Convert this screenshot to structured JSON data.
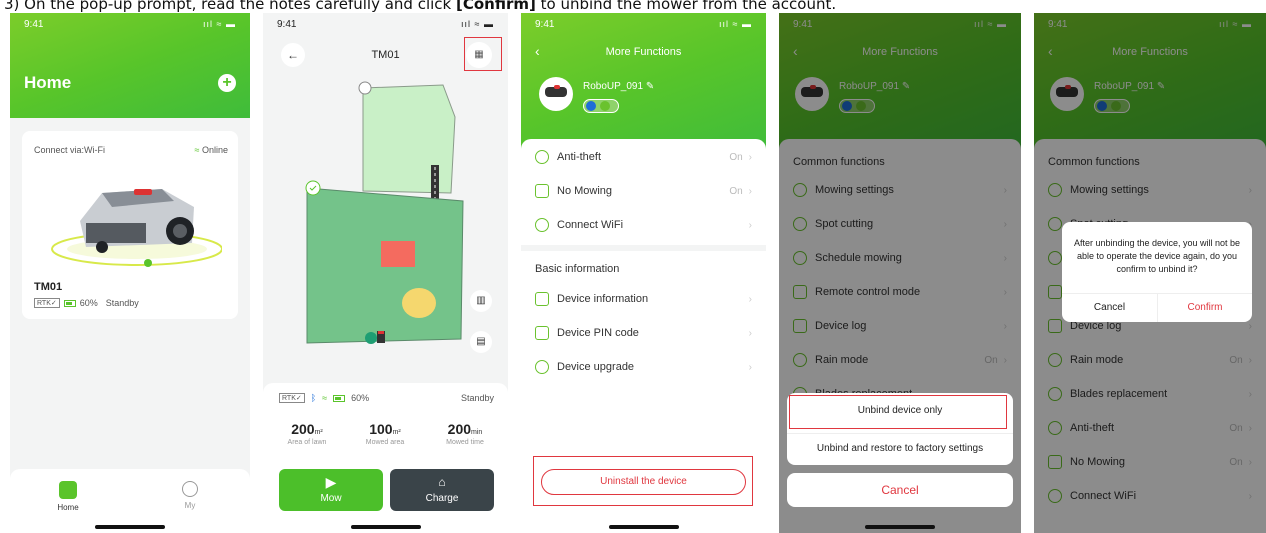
{
  "caption": {
    "prefix": "3)    On the pop-up prompt, read the notes carefully and click ",
    "bold": "[Confirm]",
    "suffix": " to unbind the mower from the account."
  },
  "status_time": "9:41",
  "status_icons": "ııl ≈ ▬",
  "screen1": {
    "title": "Home",
    "connect": "Connect via:Wi-Fi",
    "online": "Online",
    "device": "TM01",
    "rtk": "RTK✓",
    "battery": "60%",
    "state": "Standby",
    "tab_home": "Home",
    "tab_my": "My",
    "colors": {
      "accent": "#5ac42b"
    }
  },
  "screen2": {
    "title": "TM01",
    "rtk": "RTK✓",
    "battery": "60%",
    "state": "Standby",
    "stats": [
      {
        "value": "200",
        "unit": "m²",
        "label": "Area of lawn"
      },
      {
        "value": "100",
        "unit": "m²",
        "label": "Mowed area"
      },
      {
        "value": "200",
        "unit": "min",
        "label": "Mowed time"
      }
    ],
    "mow": "Mow",
    "charge": "Charge"
  },
  "screen3": {
    "title": "More Functions",
    "device": "RoboUP_091",
    "rows": [
      {
        "icon": "shield-icon",
        "label": "Anti-theft",
        "value": "On"
      },
      {
        "icon": "no-mow-icon",
        "label": "No Mowing",
        "value": "On"
      },
      {
        "icon": "wifi-icon",
        "label": "Connect WiFi",
        "value": ""
      }
    ],
    "basic_title": "Basic information",
    "basic_rows": [
      {
        "icon": "info-icon",
        "label": "Device information"
      },
      {
        "icon": "pin-icon",
        "label": "Device PIN code"
      },
      {
        "icon": "cloud-icon",
        "label": "Device upgrade"
      }
    ],
    "uninstall": "Uninstall the device"
  },
  "screen4": {
    "title": "More Functions",
    "device": "RoboUP_091",
    "common_title": "Common functions",
    "rows": [
      {
        "label": "Mowing settings",
        "value": ""
      },
      {
        "label": "Spot cutting",
        "value": ""
      },
      {
        "label": "Schedule mowing",
        "value": ""
      },
      {
        "label": "Remote control mode",
        "value": ""
      },
      {
        "label": "Device log",
        "value": ""
      },
      {
        "label": "Rain mode",
        "value": "On"
      },
      {
        "label": "Blades replacement",
        "value": ""
      }
    ],
    "sheet_option1": "Unbind device only",
    "sheet_option2": "Unbind and restore to factory settings",
    "sheet_cancel": "Cancel"
  },
  "screen5": {
    "title": "More Functions",
    "device": "RoboUP_091",
    "common_title": "Common functions",
    "rows": [
      {
        "label": "Mowing settings",
        "value": ""
      },
      {
        "label": "Spot cutting",
        "value": ""
      },
      {
        "label": "",
        "value": ""
      },
      {
        "label": "",
        "value": ""
      },
      {
        "label": "Device log",
        "value": ""
      },
      {
        "label": "Rain mode",
        "value": "On"
      },
      {
        "label": "Blades replacement",
        "value": ""
      },
      {
        "label": "Anti-theft",
        "value": "On"
      },
      {
        "label": "No Mowing",
        "value": "On"
      },
      {
        "label": "Connect WiFi",
        "value": ""
      }
    ],
    "dialog_text": "After unbinding the device, you will not be able to operate the device again, do you confirm to unbind it?",
    "cancel": "Cancel",
    "confirm": "Confirm",
    "confirm_color": "#e0373f"
  }
}
